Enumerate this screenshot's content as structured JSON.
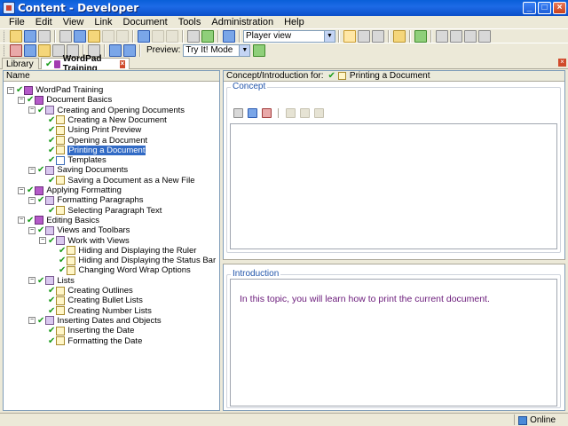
{
  "window": {
    "title": "Content - Developer"
  },
  "menu": [
    "File",
    "Edit",
    "View",
    "Link",
    "Document",
    "Tools",
    "Administration",
    "Help"
  ],
  "toolbar": {
    "view_combo": "Player view",
    "preview_label": "Preview:",
    "preview_combo": "Try It! Mode"
  },
  "tabs": [
    {
      "label": "Library"
    },
    {
      "label": "WordPad Training"
    }
  ],
  "tree": {
    "header": "Name",
    "nodes": [
      {
        "label": "WordPad Training",
        "level": 0,
        "icon": "book"
      },
      {
        "label": "Document Basics",
        "level": 1,
        "icon": "book"
      },
      {
        "label": "Creating and Opening Documents",
        "level": 2,
        "icon": "section"
      },
      {
        "label": "Creating a New Document",
        "level": 3,
        "icon": "topic"
      },
      {
        "label": "Using Print Preview",
        "level": 3,
        "icon": "topic"
      },
      {
        "label": "Opening a Document",
        "level": 3,
        "icon": "topic"
      },
      {
        "label": "Printing a Document",
        "level": 3,
        "icon": "topic",
        "selected": true
      },
      {
        "label": "Templates",
        "level": 3,
        "icon": "page"
      },
      {
        "label": "Saving Documents",
        "level": 2,
        "icon": "section"
      },
      {
        "label": "Saving a Document as a New File",
        "level": 3,
        "icon": "topic"
      },
      {
        "label": "Applying Formatting",
        "level": 1,
        "icon": "book"
      },
      {
        "label": "Formatting Paragraphs",
        "level": 2,
        "icon": "section"
      },
      {
        "label": "Selecting Paragraph Text",
        "level": 3,
        "icon": "topic"
      },
      {
        "label": "Editing Basics",
        "level": 1,
        "icon": "book"
      },
      {
        "label": "Views and Toolbars",
        "level": 2,
        "icon": "section"
      },
      {
        "label": "Work with Views",
        "level": 3,
        "icon": "section"
      },
      {
        "label": "Hiding and Displaying the Ruler",
        "level": 4,
        "icon": "topic"
      },
      {
        "label": "Hiding and Displaying the Status Bar",
        "level": 4,
        "icon": "topic"
      },
      {
        "label": "Changing Word Wrap Options",
        "level": 4,
        "icon": "topic"
      },
      {
        "label": "Lists",
        "level": 2,
        "icon": "section"
      },
      {
        "label": "Creating Outlines",
        "level": 3,
        "icon": "topic"
      },
      {
        "label": "Creating Bullet Lists",
        "level": 3,
        "icon": "topic"
      },
      {
        "label": "Creating Number Lists",
        "level": 3,
        "icon": "topic"
      },
      {
        "label": "Inserting Dates and Objects",
        "level": 2,
        "icon": "section"
      },
      {
        "label": "Inserting the Date",
        "level": 3,
        "icon": "topic"
      },
      {
        "label": "Formatting the Date",
        "level": 3,
        "icon": "topic"
      }
    ]
  },
  "details": {
    "header_prefix": "Concept/Introduction for:",
    "header_item": "Printing a Document",
    "concept_legend": "Concept",
    "intro_legend": "Introduction",
    "intro_text": "In this topic, you will learn how to print the current document."
  },
  "status": {
    "text": "Online"
  }
}
